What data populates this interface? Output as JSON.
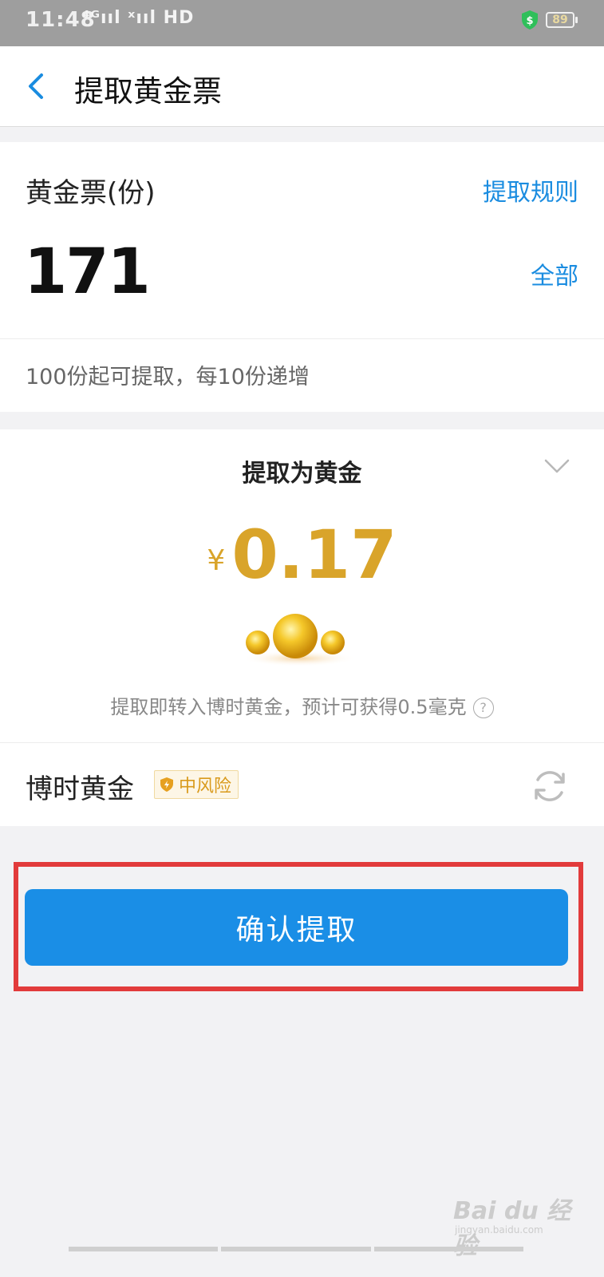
{
  "status_bar": {
    "time": "11:48",
    "signal": "⁴ᴳııl ˣııl HD",
    "battery": "89"
  },
  "nav": {
    "back_icon": "chevron-left-icon",
    "title": "提取黄金票"
  },
  "tickets": {
    "label": "黄金票(份)",
    "rules_link": "提取规则",
    "amount": "171",
    "all_link": "全部",
    "hint": "100份起可提取，每10份递增"
  },
  "withdraw": {
    "method_label": "提取为黄金",
    "currency_symbol": "¥",
    "value": "0.17",
    "note": "提取即转入博时黄金，预计可获得0.5毫克",
    "help_symbol": "?"
  },
  "fund": {
    "name": "博时黄金",
    "risk_label": "中风险"
  },
  "confirm_label": "确认提取",
  "watermark": {
    "main": "Bai du 经验",
    "sub": "jingyan.baidu.com"
  },
  "colors": {
    "accent": "#1a8ee6",
    "gold": "#d9a42a",
    "highlight": "#e23b3b",
    "link": "#1a8ce0"
  }
}
